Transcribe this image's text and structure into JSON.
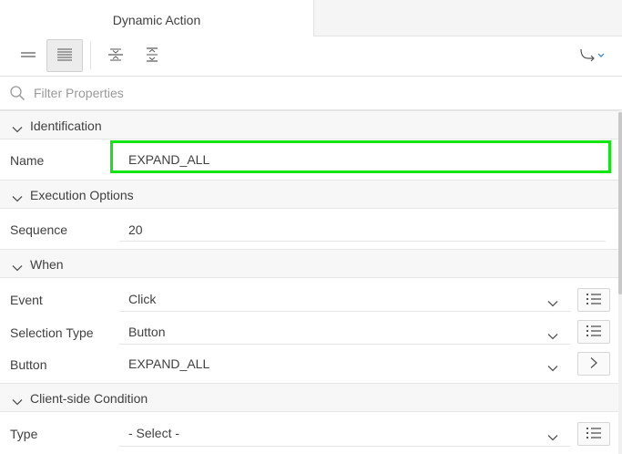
{
  "tabs": [
    {
      "label": "Dynamic Action"
    }
  ],
  "toolbar": {
    "buttons": [
      {
        "icon": "show-common-icon"
      },
      {
        "icon": "show-all-icon",
        "active": true
      },
      {
        "icon": "collapse-all-icon"
      },
      {
        "icon": "expand-all-icon"
      },
      {
        "icon": "go-to-group-icon"
      }
    ]
  },
  "filter": {
    "placeholder": "Filter Properties"
  },
  "groups": {
    "identification": {
      "title": "Identification",
      "name_label": "Name",
      "name_value": "EXPAND_ALL"
    },
    "execution": {
      "title": "Execution Options",
      "sequence_label": "Sequence",
      "sequence_value": "20"
    },
    "when": {
      "title": "When",
      "event_label": "Event",
      "event_value": "Click",
      "selection_type_label": "Selection Type",
      "selection_type_value": "Button",
      "button_label": "Button",
      "button_value": "EXPAND_ALL"
    },
    "client_condition": {
      "title": "Client-side Condition",
      "type_label": "Type",
      "type_value": "- Select -"
    }
  },
  "colors": {
    "highlight": "#12e612",
    "group_header_bg": "#f7f7f7",
    "border": "#e2e2e2"
  }
}
